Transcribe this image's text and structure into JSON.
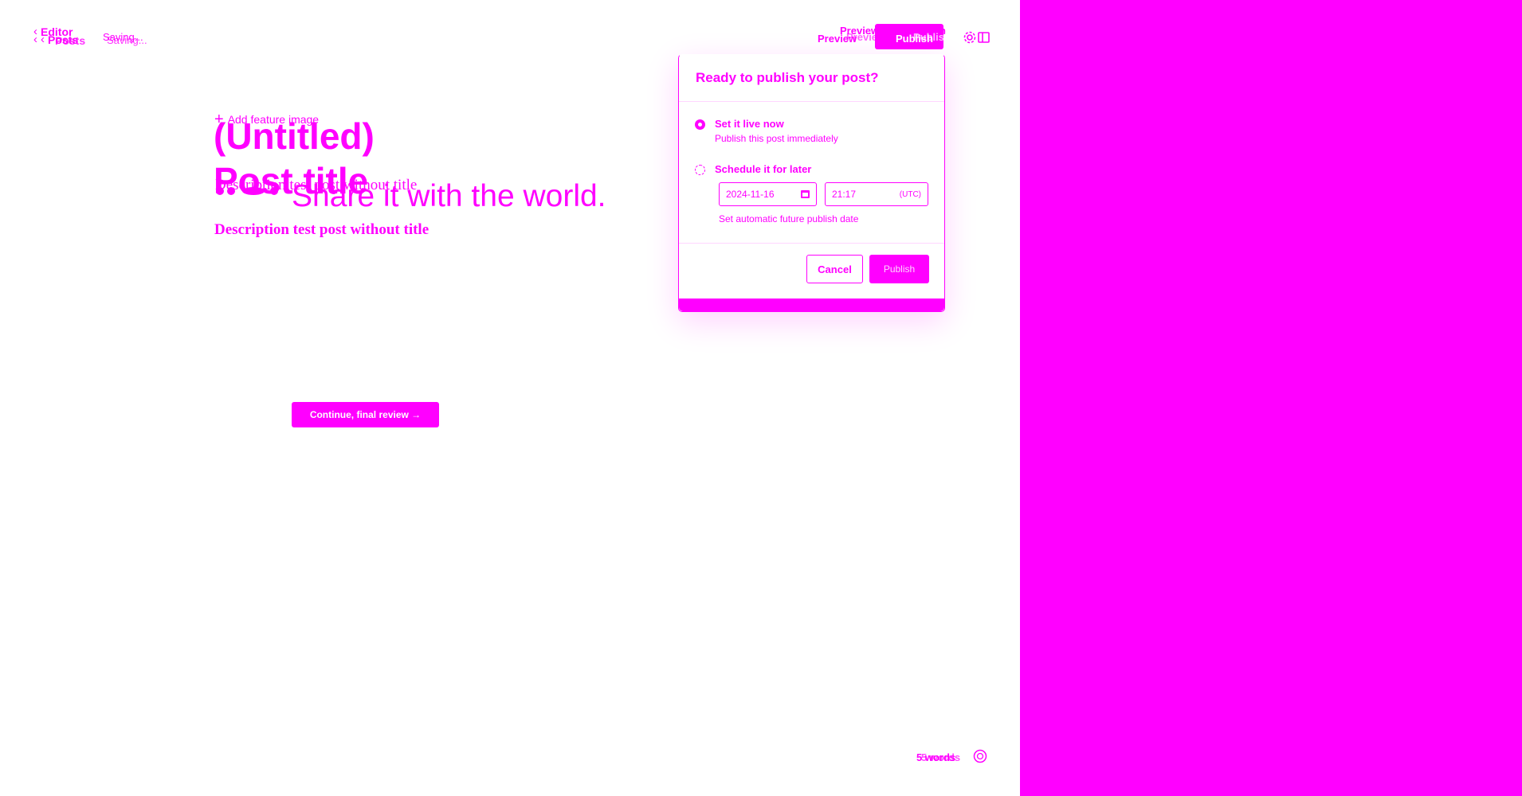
{
  "colors": {
    "accent": "#ff00ff",
    "background": "#ffffff"
  },
  "topbar": {
    "back_label_a": "Editor",
    "back_label_b": "Posts",
    "back_label_c": "Posts",
    "status_a": "Saving...",
    "status_b": "Saving...",
    "preview_a": "Preview",
    "preview_b": "Preview",
    "preview_c": "Preview",
    "publish_a": "Publish",
    "publish_b": "Publish",
    "publish_c": "Publish"
  },
  "editor": {
    "add_feature_image": "Add feature image",
    "title_placeholder": "(Untitled)",
    "title_ghost": "Post title",
    "excerpt_ghost": "Description test post without title",
    "headline": "Share it with the world.",
    "description": "Description test post without title",
    "continue_button": "Continue, final review →"
  },
  "publish_menu": {
    "header": "Ready to publish your post?",
    "option_now": {
      "title": "Set it live now",
      "subtitle": "Publish this post immediately",
      "selected": true
    },
    "option_later": {
      "title": "Schedule it for later",
      "selected": false
    },
    "date_value": "2024-11-16",
    "time_value": "21:17",
    "timezone": "(UTC)",
    "schedule_help": "Set automatic future publish date",
    "cancel": "Cancel",
    "publish": "Publish"
  },
  "footer": {
    "word_count_a": "5 words",
    "word_count_b": "5 words"
  },
  "icons": [
    "chevron-left-icon",
    "gear-icon",
    "sidebar-toggle-icon",
    "plus-icon",
    "calendar-icon",
    "help-icon",
    "arrow-right-icon"
  ]
}
